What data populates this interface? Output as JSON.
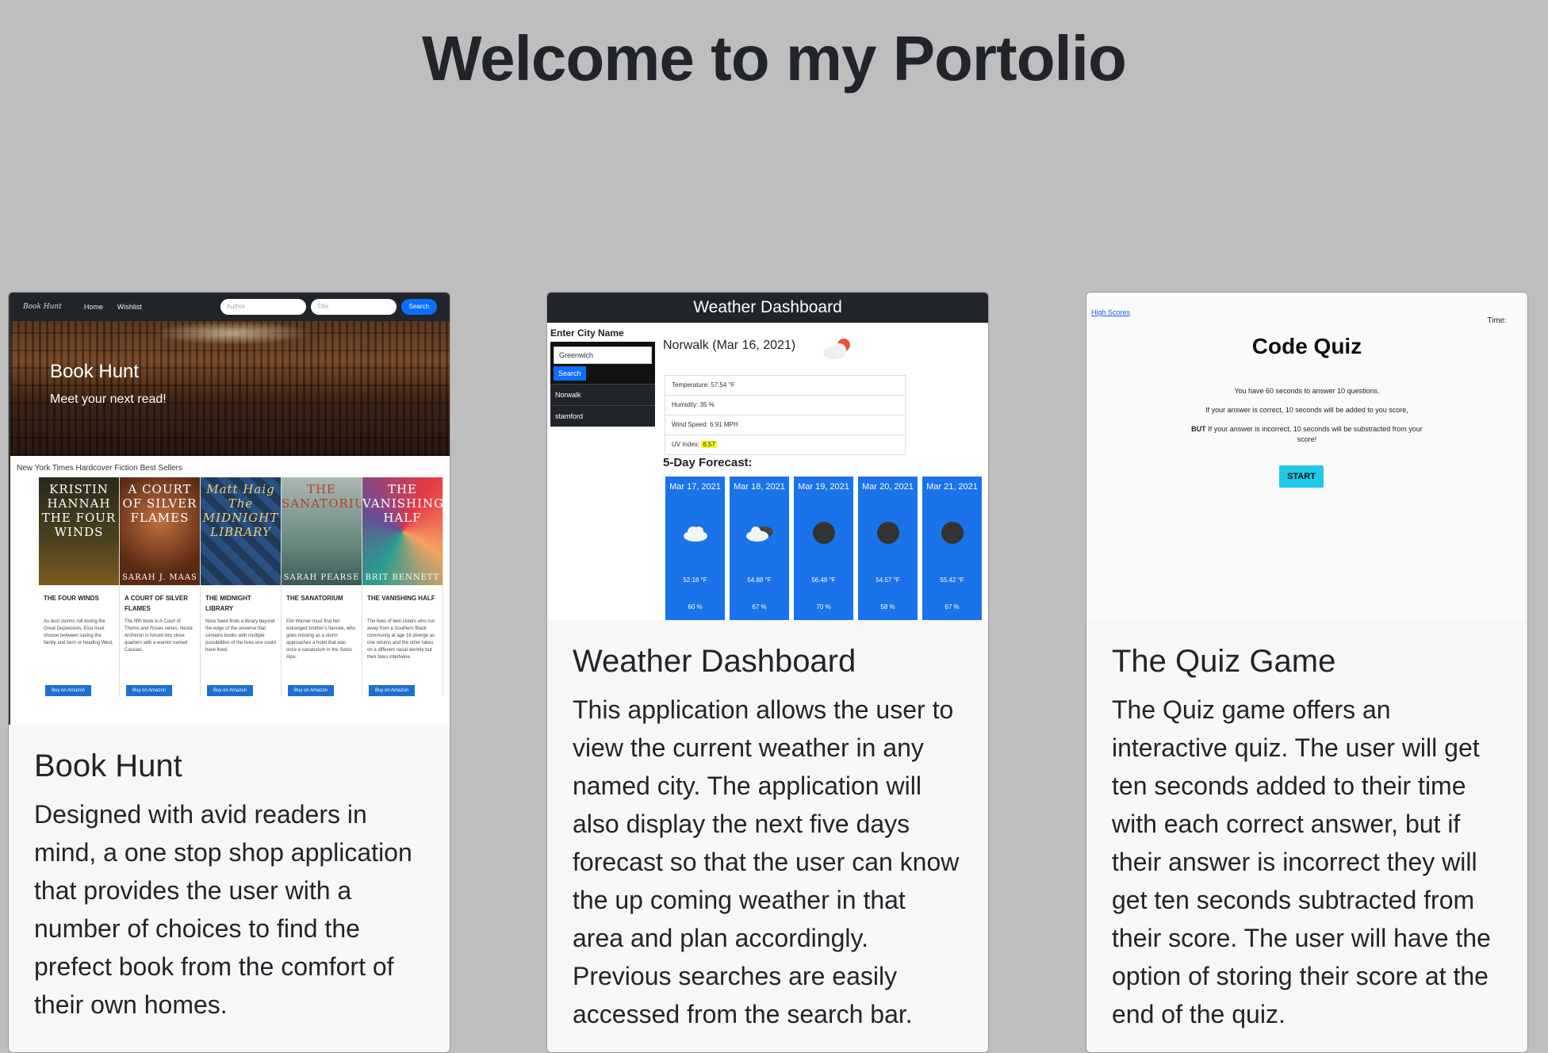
{
  "page": {
    "title": "Welcome to my Portolio"
  },
  "cards": [
    {
      "title": "Book Hunt",
      "text": "Designed with avid readers in mind, a one stop shop application that provides the user with a number of choices to find the prefect book from the comfort of their own homes.",
      "preview": {
        "brand": "Book Hunt",
        "nav": [
          "Home",
          "Wishlist"
        ],
        "author_placeholder": "Author",
        "title_placeholder": "Title",
        "search_label": "Search",
        "hero_title": "Book Hunt",
        "hero_subtitle": "Meet your next read!",
        "section_title": "New York Times Hardcover Fiction Best Sellers",
        "books": [
          {
            "cover_text": "KRISTIN HANNAH THE FOUR WINDS",
            "cover_author": "",
            "title": "THE FOUR WINDS",
            "desc": "As dust storms roll during the Great Depression, Elsa must choose between saving the family and farm or heading West.",
            "buy": "Buy on Amazon"
          },
          {
            "cover_text": "A COURT OF SILVER FLAMES",
            "cover_author": "SARAH J. MAAS",
            "title": "A COURT OF SILVER FLAMES",
            "desc": "The fifth book in A Court of Thorns and Roses series. Nesta Archeron is forced into close quarters with a warrior named Cassian.",
            "buy": "Buy on Amazon"
          },
          {
            "cover_text": "Matt Haig The MIDNIGHT LIBRARY",
            "cover_author": "",
            "title": "THE MIDNIGHT LIBRARY",
            "desc": "Nora Seed finds a library beyond the edge of the universe that contains books with multiple possibilities of the lives one could have lived.",
            "buy": "Buy on Amazon"
          },
          {
            "cover_text": "THE SANATORIUM",
            "cover_author": "SARAH PEARSE",
            "title": "THE SANATORIUM",
            "desc": "Elin Warner must find her estranged brother's fiancée, who goes missing as a storm approaches a hotel that was once a sanatorium in the Swiss Alps.",
            "buy": "Buy on Amazon"
          },
          {
            "cover_text": "THE VANISHING HALF",
            "cover_author": "BRIT BENNETT",
            "title": "THE VANISHING HALF",
            "desc": "The lives of twin sisters who run away from a Southern Black community at age 16 diverge as one returns and the other takes on a different racial identity but their fates intertwine.",
            "buy": "Buy on Amazon"
          }
        ]
      }
    },
    {
      "title": "Weather Dashboard",
      "text": "This application allows the user to view the current weather in any named city. The application will also display the next five days forecast so that the user can know the up coming weather in that area and plan accordingly. Previous searches are easily accessed from the search bar.",
      "preview": {
        "header": "Weather Dashboard",
        "city_label": "Enter City Name",
        "input_value": "Greenwich",
        "search_label": "Search",
        "history": [
          "Norwalk",
          "stamford"
        ],
        "current_city": "Norwalk (Mar 16, 2021)",
        "temperature": "Temperature: 57.54 °F",
        "humidity": "Humidity: 35 %",
        "wind": "Wind Speed: 6.91 MPH",
        "uv_label": "UV Index:",
        "uv_value": "6.57",
        "forecast_label": "5-Day Forecast:",
        "days": [
          {
            "date": "Mar 17, 2021",
            "icon": "cloud-icon",
            "temp": "52.18 °F",
            "humidity": "60 %"
          },
          {
            "date": "Mar 18, 2021",
            "icon": "cloud-rain-icon",
            "temp": "54.88 °F",
            "humidity": "67 %"
          },
          {
            "date": "Mar 19, 2021",
            "icon": "moon-icon",
            "temp": "56.48 °F",
            "humidity": "70 %"
          },
          {
            "date": "Mar 20, 2021",
            "icon": "moon-icon",
            "temp": "54.57 °F",
            "humidity": "58 %"
          },
          {
            "date": "Mar 21, 2021",
            "icon": "moon-icon",
            "temp": "55.42 °F",
            "humidity": "67 %"
          }
        ]
      }
    },
    {
      "title": "The Quiz Game",
      "text": "The Quiz game offers an interactive quiz. The user will get ten seconds added to their time with each correct answer, but if their answer is incorrect they will get ten seconds subtracted from their score. The user will have the option of storing their score at the end of the quiz.",
      "preview": {
        "high_scores": "High Scores",
        "time_label": "Time:",
        "title": "Code Quiz",
        "line1": "You have 60 seconds to answer 10 questions.",
        "line2": "If your answer is correct, 10 seconds will be added to you score,",
        "line3_bold": "BUT",
        "line3": "If your answer is incorrect, 10 seconds will be substracted from your score!",
        "start_label": "START"
      }
    }
  ],
  "colors": {
    "background": "#bebebe",
    "card": "#f8f7f8",
    "primary": "#1a73e8",
    "quiz_button": "#1ec8e6"
  }
}
